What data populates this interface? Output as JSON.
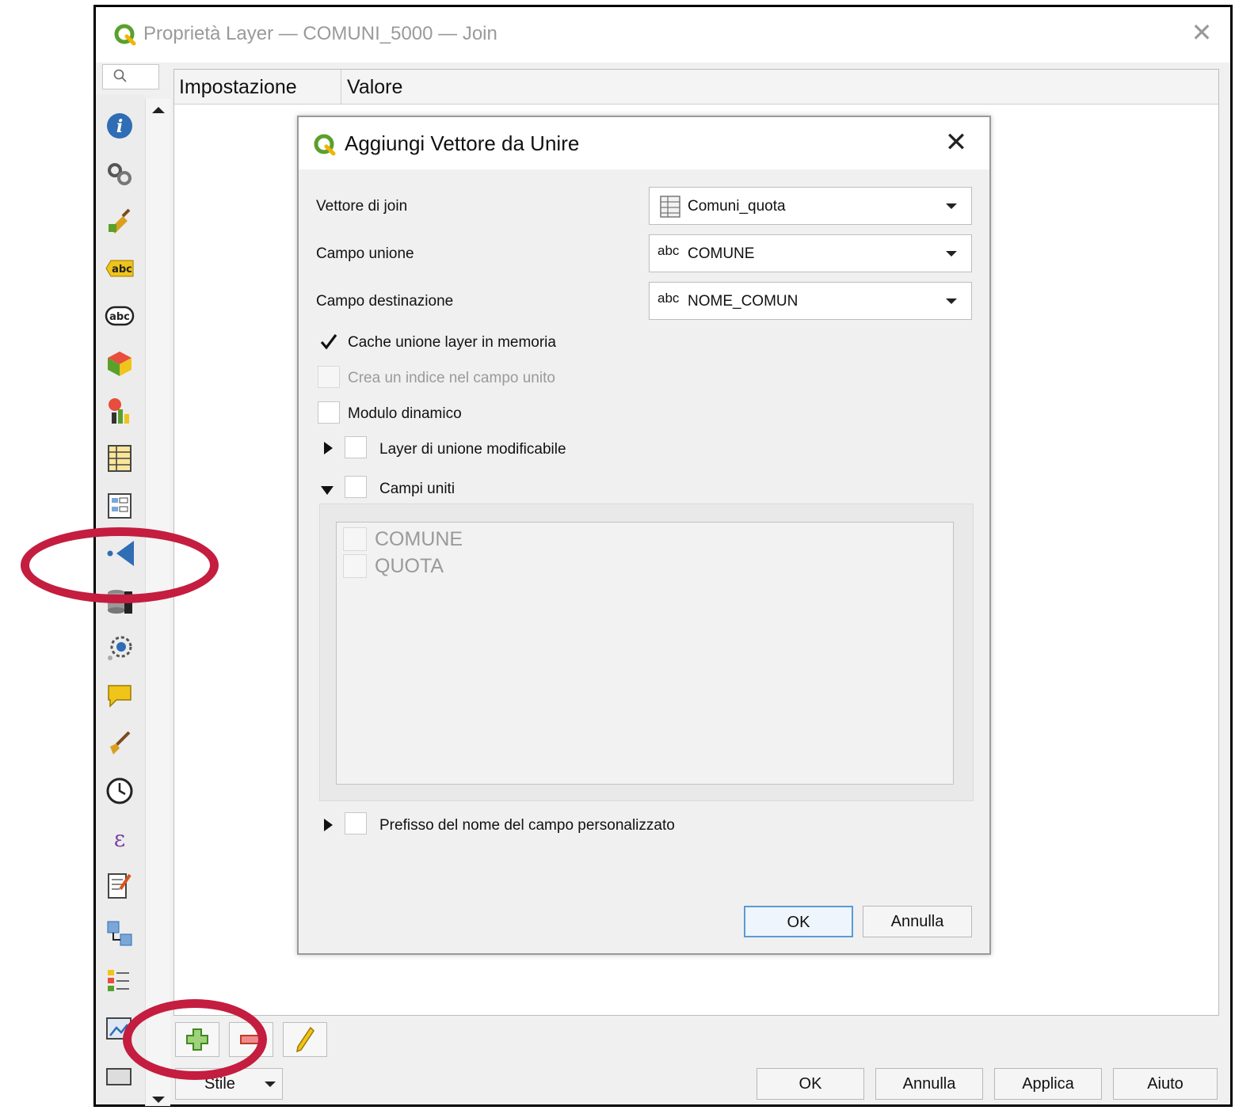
{
  "window": {
    "title": "Proprietà Layer — COMUNI_5000 — Join",
    "close_glyph": "✕"
  },
  "table": {
    "col_setting": "Impostazione",
    "col_value": "Valore"
  },
  "sidebar": {
    "icons": [
      "info-icon",
      "source-icon",
      "symbology-icon",
      "labels-icon",
      "masks-icon",
      "3d-view-icon",
      "diagrams-icon",
      "fields-icon",
      "attributes-form-icon",
      "joins-icon",
      "auxiliary-storage-icon",
      "actions-icon",
      "display-icon",
      "rendering-icon",
      "temporal-icon",
      "variables-icon",
      "metadata-icon",
      "dependencies-icon",
      "legend-icon",
      "qgis-server-icon",
      "digitizing-icon"
    ]
  },
  "toolbar": {
    "add_icon": "plus-icon",
    "remove_icon": "minus-icon",
    "edit_icon": "pencil-icon"
  },
  "footer": {
    "style_label": "Stile",
    "ok": "OK",
    "cancel": "Annulla",
    "apply": "Applica",
    "help": "Aiuto"
  },
  "dialog": {
    "title": "Aggiungi Vettore da Unire",
    "close_glyph": "✕",
    "join_layer_label": "Vettore di join",
    "join_layer_value": "Comuni_quota",
    "join_field_label": "Campo unione",
    "join_field_value": "COMUNE",
    "target_field_label": "Campo destinazione",
    "target_field_value": "NOME_COMUN",
    "field_type_prefix": "abc",
    "cache_label": "Cache unione layer in memoria",
    "cache_checked": true,
    "index_label": "Crea un indice nel campo unito",
    "dynamic_form_label": "Modulo dinamico",
    "editable_label": "Layer di unione modificabile",
    "joined_fields_label": "Campi uniti",
    "joined_fields": [
      "COMUNE",
      "QUOTA"
    ],
    "prefix_label": "Prefisso del nome del campo personalizzato",
    "ok": "OK",
    "cancel": "Annulla"
  },
  "colors": {
    "annotation_ring": "#c41d3f",
    "qgis_green": "#5aa02c"
  }
}
